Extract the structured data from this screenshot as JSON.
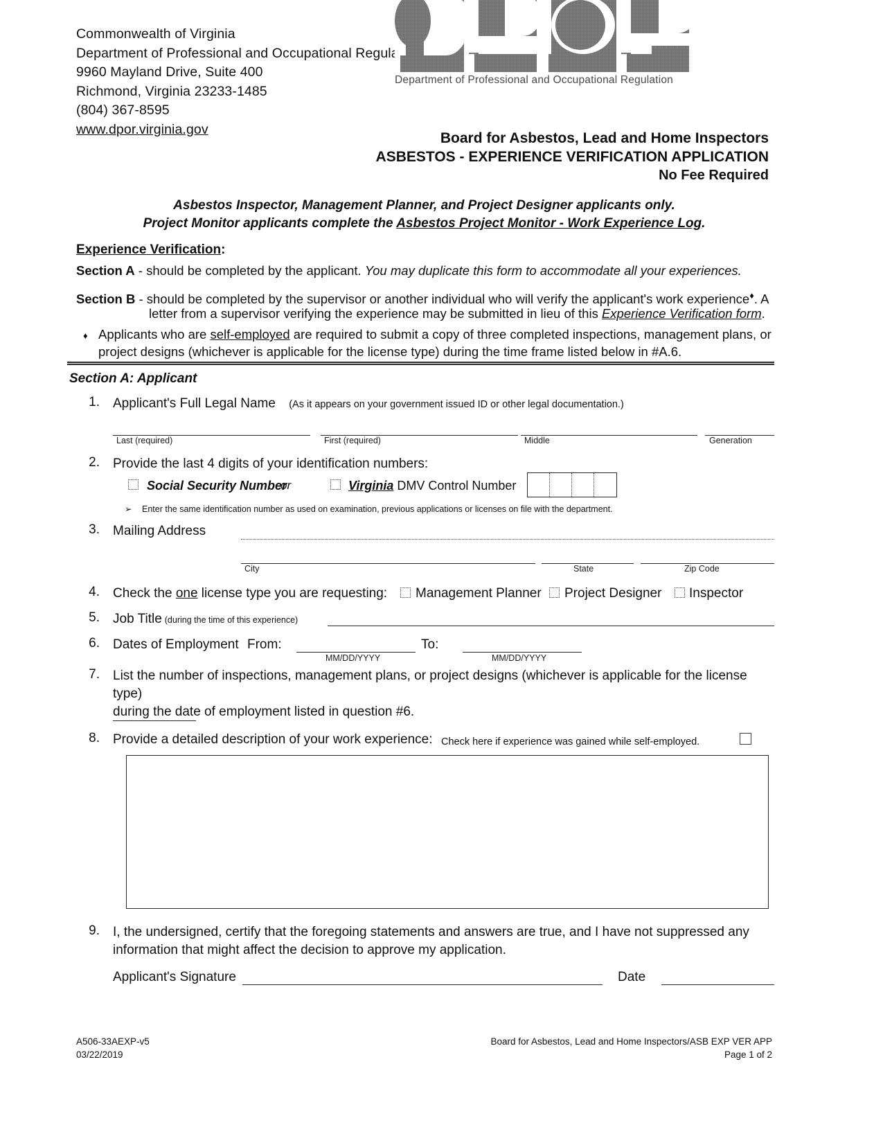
{
  "header": {
    "address_lines": [
      "Commonwealth of Virginia",
      "Department of Professional and Occupational Regulation",
      "9960 Mayland Drive, Suite 400",
      "Richmond, Virginia 23233-1485",
      "(804) 367-8595"
    ],
    "website": "www.dpor.virginia.gov",
    "logo_text": "DPOR",
    "logo_tagline": "Department of Professional and Occupational Regulation"
  },
  "titles": {
    "board": "Board for Asbestos, Lead and Home Inspectors",
    "form": "ASBESTOS - EXPERIENCE VERIFICATION APPLICATION",
    "fee": "No Fee Required"
  },
  "intro": {
    "line1": "Asbestos Inspector, Management Planner, and Project Designer applicants only.",
    "line2_pre": "Project Monitor applicants complete the ",
    "line2_underlined": "Asbestos Project Monitor - Work Experience Log",
    "line2_post": ".",
    "experience_verification": "Experience Verification",
    "experience_verification_colon": ":",
    "section_a_label": "Section A",
    "section_a_text": " -  should be completed by the applicant.   ",
    "section_a_italic": "You may duplicate this form to accommodate all your experiences.",
    "section_b_label": "Section B",
    "section_b_text": " - should be completed by the supervisor or another individual who will verify the applicant's work experience",
    "section_b_marker": "♦",
    "section_b_tail": ". A",
    "section_b_line2_pre": "letter from a supervisor verifying the experience may be submitted in lieu of this ",
    "section_b_line2_italic_underlined": "Experience Verification form",
    "section_b_line2_post": ".",
    "bullet_marker": "♦",
    "bullet_pre": "Applicants who are ",
    "bullet_underlined": "self-employed",
    "bullet_post": " are required to submit a copy of three completed inspections, management plans, or",
    "bullet_line2": "project designs (whichever is applicable for the license type) during the time frame listed below in #A.6."
  },
  "section_a": {
    "heading": "Section A:  Applicant",
    "q1": {
      "num": "1.",
      "label": "Applicant's Full Legal Name",
      "note": "(As it appears on your government issued ID or other legal documentation.)",
      "field_last": "Last  (required)",
      "field_first": "First  (required)",
      "field_middle": "Middle",
      "field_generation": "Generation"
    },
    "q2": {
      "num": "2.",
      "label": "Provide the last 4 digits of your identification numbers:",
      "ssn_label": "Social Security Number",
      "or_label": "or",
      "virginia_label": "Virginia",
      "dmv_label": " DMV Control Number",
      "arrow": "➢",
      "note": "Enter the same identification number as used on examination, previous applications or licenses on file with the department."
    },
    "q3": {
      "num": "3.",
      "label": "Mailing Address",
      "field_city": "City",
      "field_state": "State",
      "field_zip": "Zip Code"
    },
    "q4": {
      "num": "4.",
      "label_pre": "Check the ",
      "label_underlined": "one",
      "label_post": " license type you are requesting:",
      "opt1": "Management Planner",
      "opt2": "Project Designer",
      "opt3": "Inspector"
    },
    "q5": {
      "num": "5.",
      "label": "Job Title",
      "note": "(during the time of this experience)"
    },
    "q6": {
      "num": "6.",
      "label": "Dates of Employment",
      "from_label": "From:",
      "to_label": "To:",
      "from_format": "MM/DD/YYYY",
      "to_format": "MM/DD/YYYY"
    },
    "q7": {
      "num": "7.",
      "line1": "List the number of inspections, management plans, or project designs (whichever is applicable  for the license type)",
      "line2": "during the date of employment listed in question #6."
    },
    "q8": {
      "num": "8.",
      "label": "Provide a detailed description of your work experience:",
      "self_employed_note": "Check here if experience was gained while self-employed."
    },
    "q9": {
      "num": "9.",
      "line1": "I, the undersigned, certify that the foregoing statements and answers are true, and I have not suppressed any",
      "line2": "information that might affect the decision to approve my application.",
      "signature_label": "Applicant's Signature",
      "date_label": "Date"
    }
  },
  "footer": {
    "form_code": "A506-33AEXP-v5",
    "revision_date": "03/22/2019",
    "right_line1": "Board for Asbestos, Lead and Home Inspectors/ASB EXP VER APP",
    "right_line2": "Page 1 of 2"
  }
}
